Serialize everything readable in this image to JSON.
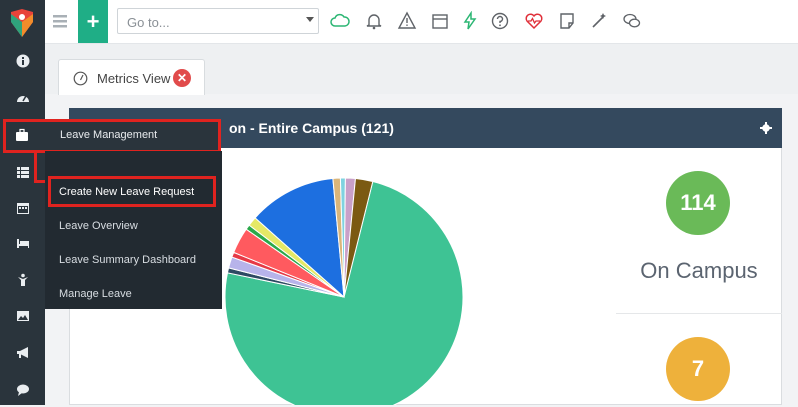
{
  "topbar": {
    "goto_placeholder": "Go to...",
    "plus_label": "+",
    "icons": [
      "menu-icon",
      "cloud-icon",
      "bell-icon",
      "warning-icon",
      "calendar-icon",
      "lightning-icon",
      "help-icon",
      "heart-pulse-icon",
      "note-icon",
      "magic-wand-icon",
      "chat-icon"
    ]
  },
  "tab": {
    "label": "Metrics View",
    "close": "✕"
  },
  "panel": {
    "title": "on - Entire Campus (121)"
  },
  "stats": [
    {
      "value": "114",
      "label": "On Campus",
      "color": "#6aba58"
    },
    {
      "value": "7",
      "color": "#eeb13b"
    }
  ],
  "menu": {
    "header": "Leave Management",
    "items": [
      "Create New Leave Request",
      "Leave Overview",
      "Leave Summary Dashboard",
      "Manage Leave"
    ]
  },
  "rail": {
    "icons": [
      "info-icon",
      "dashboard-icon",
      "briefcase-icon",
      "table-icon",
      "calendar-icon",
      "bed-icon",
      "person-icon",
      "image-icon",
      "megaphone-icon",
      "chat-icon"
    ]
  },
  "chart_data": {
    "type": "pie",
    "slices": [
      {
        "value": 88.5,
        "color": "#3ec394"
      },
      {
        "value": 0.8,
        "color": "#2d4a63"
      },
      {
        "value": 1.8,
        "color": "#b7b3ea"
      },
      {
        "value": 0.8,
        "color": "#e63946"
      },
      {
        "value": 4.2,
        "color": "#ff5a5f"
      },
      {
        "value": 0.8,
        "color": "#2aa84a"
      },
      {
        "value": 1.5,
        "color": "#e4e866"
      },
      {
        "value": 14.2,
        "color": "#1d6fe0"
      },
      {
        "value": 1.2,
        "color": "#d9b57a"
      },
      {
        "value": 0.8,
        "color": "#7fd3e0"
      },
      {
        "value": 1.6,
        "color": "#c9a0c9"
      },
      {
        "value": 2.8,
        "color": "#7b5a12"
      }
    ]
  }
}
